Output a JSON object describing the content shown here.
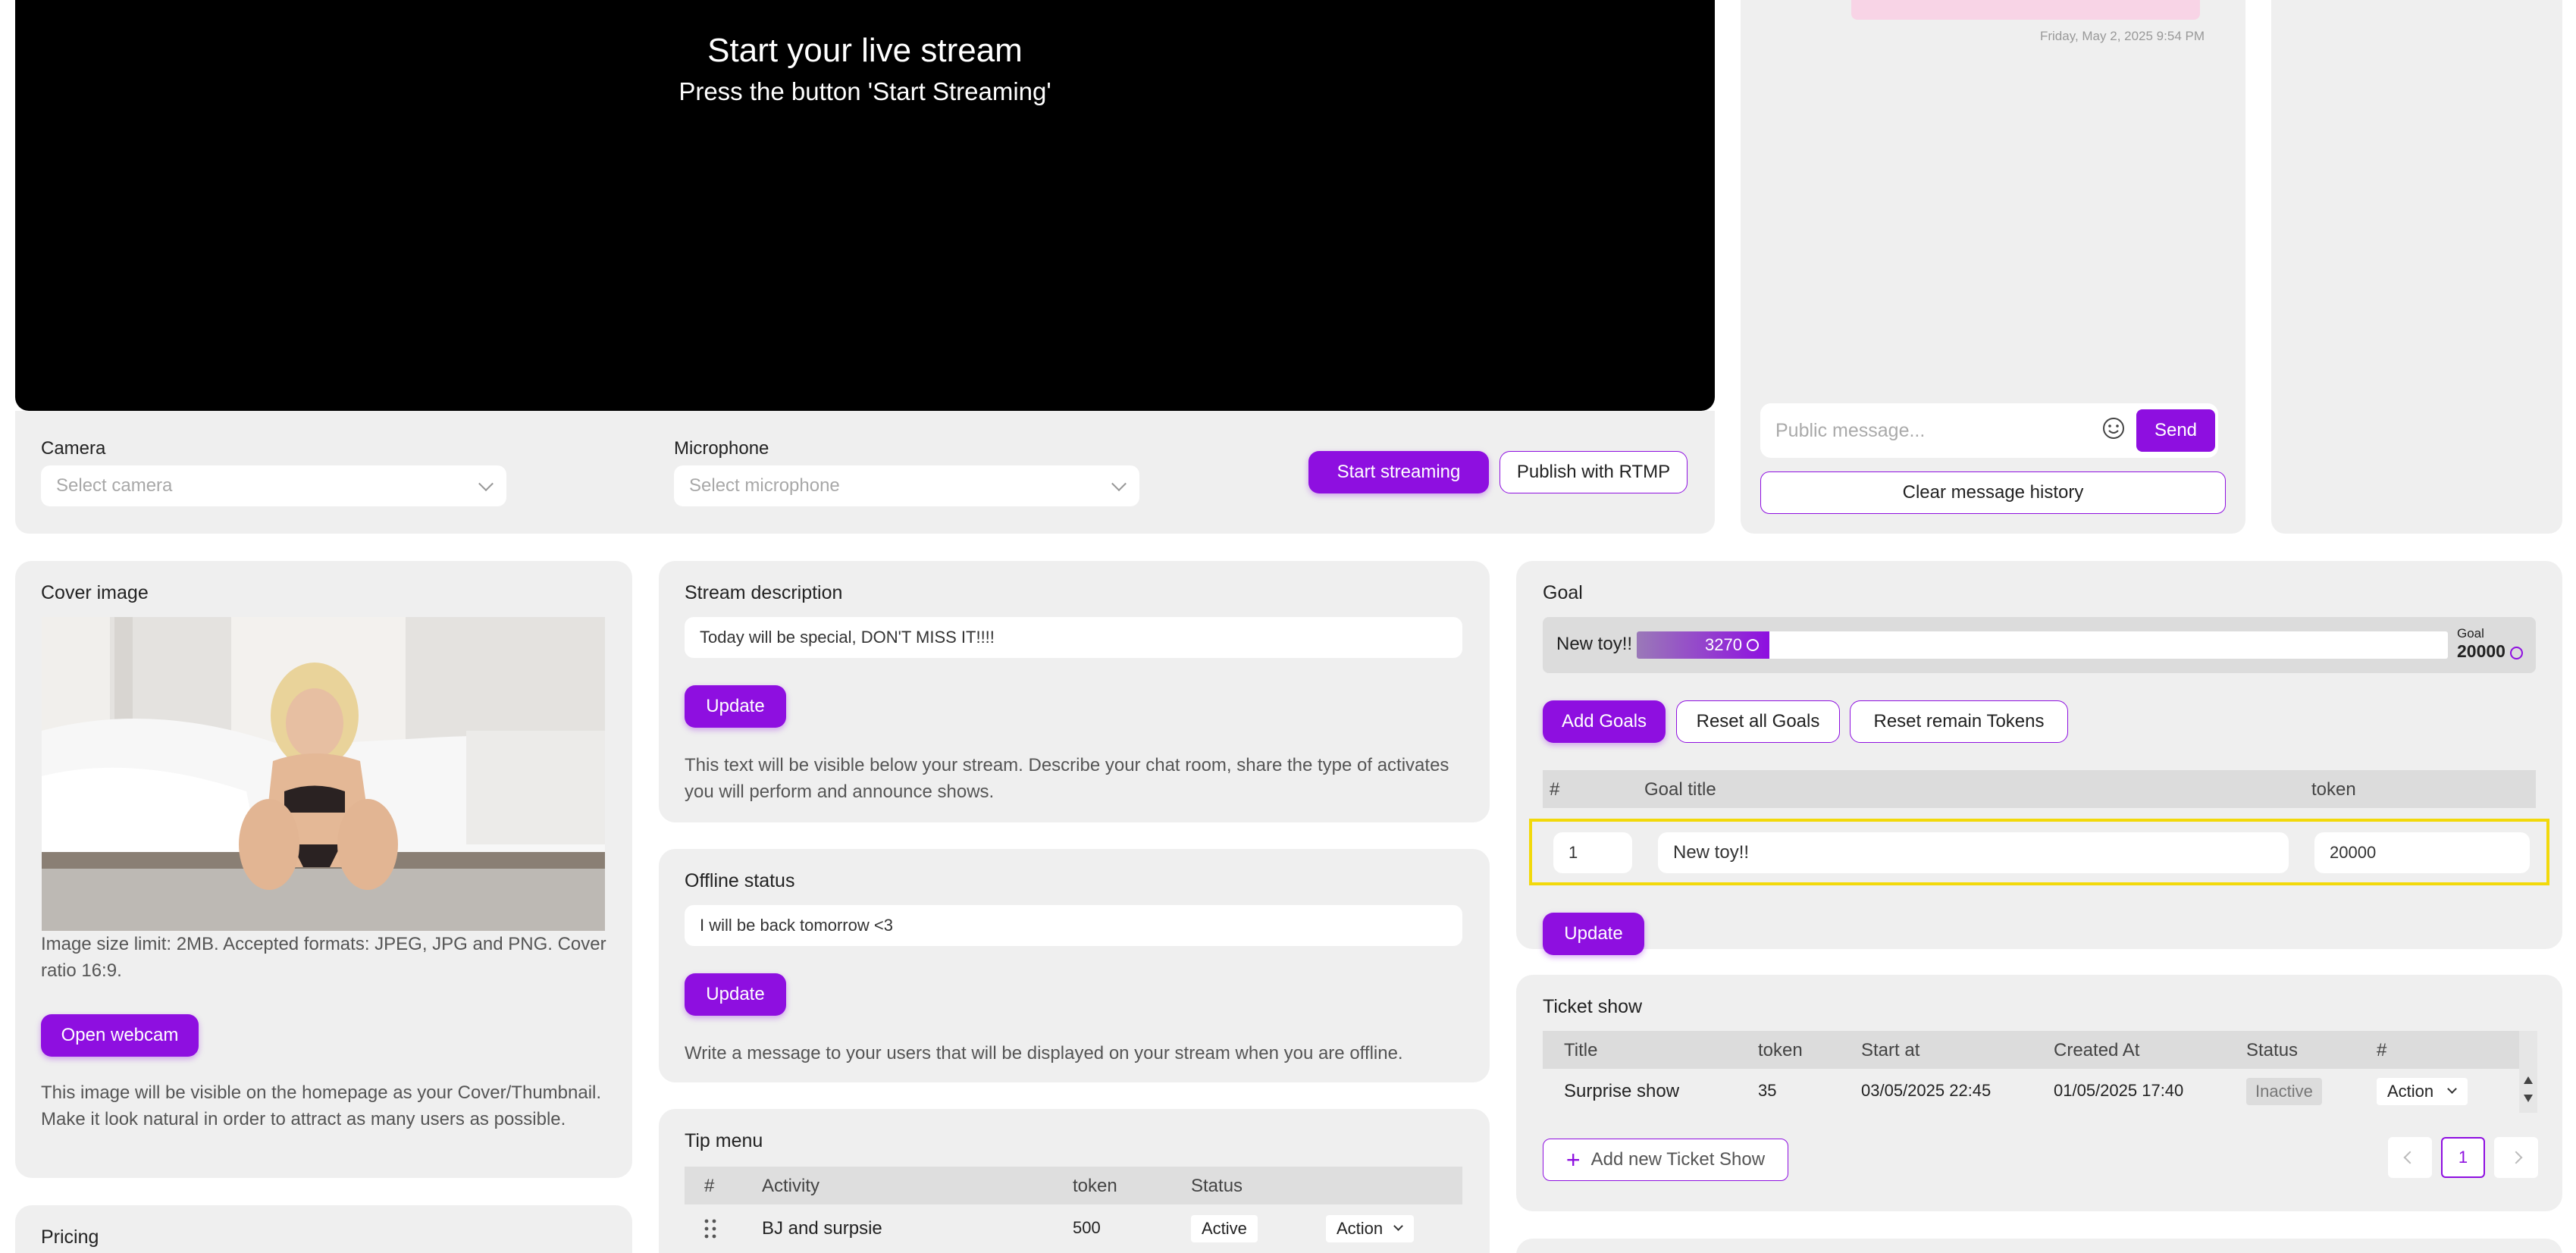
{
  "video": {
    "title": "Start your live stream",
    "subtitle": "Press the button 'Start Streaming'"
  },
  "devices": {
    "camera_label": "Camera",
    "camera_placeholder": "Select camera",
    "microphone_label": "Microphone",
    "microphone_placeholder": "Select microphone",
    "start_button": "Start streaming",
    "rtmp_button": "Publish with RTMP"
  },
  "chat": {
    "timestamp": "Friday, May 2, 2025 9:54 PM",
    "message_placeholder": "Public message...",
    "send_button": "Send",
    "clear_button": "Clear message history",
    "emoji_icon": "smiley-icon"
  },
  "cover": {
    "title": "Cover image",
    "limit_text": "Image size limit: 2MB. Accepted formats: JPEG, JPG and PNG. Cover ratio 16:9.",
    "webcam_button": "Open webcam",
    "help_text": "This image will be visible on the homepage as your Cover/Thumbnail. Make it look natural in order to attract as many users as possible."
  },
  "pricing": {
    "title": "Pricing"
  },
  "stream_description": {
    "title": "Stream description",
    "value": "Today will be special, DON'T MISS IT!!!!",
    "update_button": "Update",
    "help_text": "This text will be visible below your stream. Describe your chat room, share the type of activates you will perform and announce shows."
  },
  "offline_status": {
    "title": "Offline status",
    "value": "I will be back tomorrow <3",
    "update_button": "Update",
    "help_text": "Write a message to your users that will be displayed on your stream when you are offline."
  },
  "tip_menu": {
    "title": "Tip menu",
    "headers": [
      "#",
      "Activity",
      "token",
      "Status"
    ],
    "rows": [
      {
        "activity": "BJ and surpsie",
        "token": "500",
        "status": "Active",
        "action": "Action"
      }
    ]
  },
  "goal": {
    "title": "Goal",
    "name": "New toy!!",
    "progress_value": "3270",
    "progress_fraction": 0.1635,
    "target_label": "Goal",
    "target_value": "20000",
    "add_button": "Add Goals",
    "reset_all_button": "Reset all Goals",
    "reset_remain_button": "Reset remain Tokens",
    "headers": [
      "#",
      "Goal title",
      "token"
    ],
    "row": {
      "index": "1",
      "title": "New toy!!",
      "token": "20000"
    },
    "update_button": "Update",
    "accent_color": "#8e0fe0",
    "highlight_color": "#f2d90a"
  },
  "ticket_show": {
    "title": "Ticket show",
    "headers": [
      "Title",
      "token",
      "Start at",
      "Created At",
      "Status",
      "#"
    ],
    "rows": [
      {
        "title": "Surprise show",
        "token": "35",
        "start": "03/05/2025 22:45",
        "created": "01/05/2025 17:40",
        "status": "Inactive",
        "action": "Action"
      }
    ],
    "add_button": "Add new Ticket Show",
    "page": "1"
  }
}
